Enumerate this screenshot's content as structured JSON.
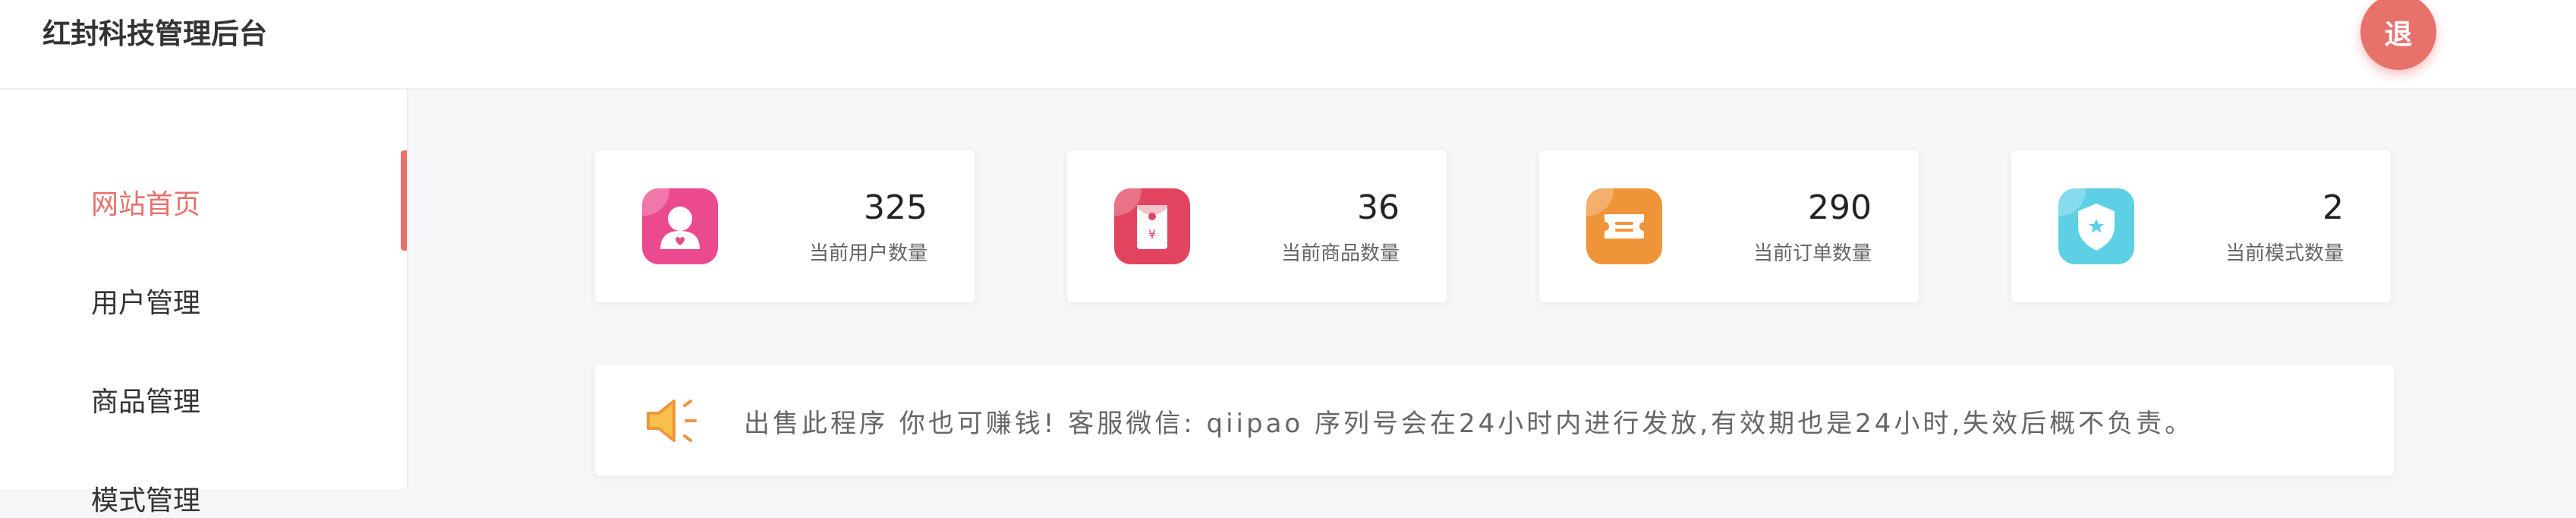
{
  "header": {
    "title": "红封科技管理后台",
    "logout_label": "退"
  },
  "sidebar": {
    "items": [
      {
        "label": "网站首页",
        "active": true
      },
      {
        "label": "用户管理",
        "active": false
      },
      {
        "label": "商品管理",
        "active": false
      },
      {
        "label": "模式管理",
        "active": false
      }
    ]
  },
  "stats": [
    {
      "value": "325",
      "label": "当前用户数量",
      "icon": "user-icon",
      "color": "#ec4a8e"
    },
    {
      "value": "36",
      "label": "当前商品数量",
      "icon": "red-envelope-icon",
      "color": "#e2435f"
    },
    {
      "value": "290",
      "label": "当前订单数量",
      "icon": "ticket-icon",
      "color": "#f0943a"
    },
    {
      "value": "2",
      "label": "当前模式数量",
      "icon": "shield-star-icon",
      "color": "#5ed0e6"
    }
  ],
  "notice": {
    "icon": "speaker-icon",
    "text": "出售此程序 你也可赚钱!  客服微信: qiipao 序列号会在24小时内进行发放,有效期也是24小时,失效后概不负责。"
  },
  "colors": {
    "accent": "#e8716c"
  }
}
